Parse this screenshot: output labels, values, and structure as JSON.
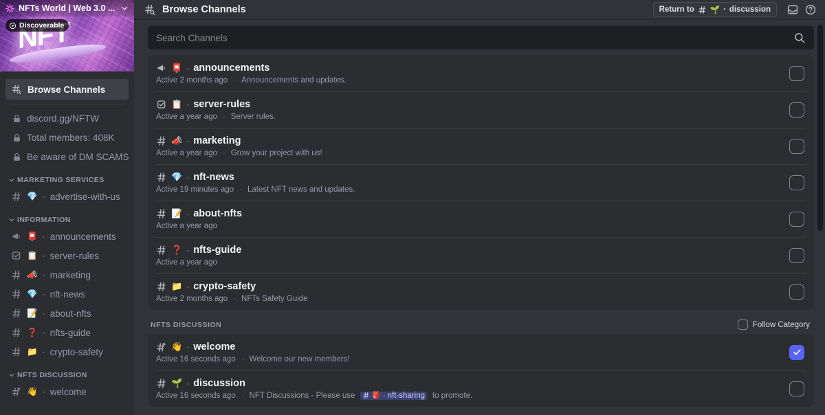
{
  "sidebar": {
    "server_name": "NFTs World | Web 3.0 ...",
    "discoverable_badge": "Discoverable",
    "banner_text": "NFT",
    "browse_channels_label": "Browse Channels",
    "info_rows": [
      {
        "icon": "lock-icon",
        "label": "discord.gg/NFTW"
      },
      {
        "icon": "lock-icon",
        "label": "Total members: 408K"
      },
      {
        "icon": "lock-icon",
        "label": "Be aware of DM SCAMS!"
      }
    ],
    "categories": [
      {
        "name": "MARKETING SERVICES",
        "channels": [
          {
            "icon": "hash-icon",
            "emoji": "💎",
            "sep": "·",
            "label": "advertise-with-us"
          }
        ]
      },
      {
        "name": "INFORMATION",
        "channels": [
          {
            "icon": "announcement-icon",
            "emoji": "📮",
            "sep": "·",
            "label": "announcements"
          },
          {
            "icon": "rules-icon",
            "emoji": "📋",
            "sep": "·",
            "label": "server-rules"
          },
          {
            "icon": "hash-icon",
            "emoji": "📣",
            "sep": "·",
            "label": "marketing"
          },
          {
            "icon": "hash-icon",
            "emoji": "💎",
            "sep": "·",
            "label": "nft-news"
          },
          {
            "icon": "hash-icon",
            "emoji": "📝",
            "sep": "·",
            "label": "about-nfts"
          },
          {
            "icon": "hash-icon",
            "emoji": "❓",
            "sep": "·",
            "label": "nfts-guide"
          },
          {
            "icon": "hash-icon",
            "emoji": "📁",
            "sep": "·",
            "label": "crypto-safety"
          }
        ]
      },
      {
        "name": "NFTS DISCUSSION",
        "channels": [
          {
            "icon": "hash-thread-icon",
            "emoji": "👋",
            "sep": "·",
            "label": "welcome"
          }
        ]
      }
    ]
  },
  "header": {
    "icon": "browse-channels-icon",
    "title": "Browse Channels",
    "return_button": {
      "label": "Return to",
      "channel_icon": "hash-icon",
      "channel_emoji": "🌱",
      "sep": "·",
      "channel_name": "discussion"
    },
    "inbox_icon": "inbox-icon",
    "help_icon": "help-icon"
  },
  "search": {
    "placeholder": "Search Channels",
    "value": "",
    "icon": "search-icon"
  },
  "channel_list": {
    "rows": [
      {
        "icon": "announcement-icon",
        "emoji": "📮",
        "sep": "·",
        "name": "announcements",
        "activity": "Active 2 months ago",
        "meta_sep": "·",
        "topic": "Announcements and updates.",
        "checked": false
      },
      {
        "icon": "rules-icon",
        "emoji": "📋",
        "sep": "·",
        "name": "server-rules",
        "activity": "Active a year ago",
        "meta_sep": "·",
        "topic": "Server rules.",
        "checked": false
      },
      {
        "icon": "hash-icon",
        "emoji": "📣",
        "sep": "·",
        "name": "marketing",
        "activity": "Active a year ago",
        "meta_sep": "·",
        "topic": "Grow your project with us!",
        "checked": false
      },
      {
        "icon": "hash-icon",
        "emoji": "💎",
        "sep": "·",
        "name": "nft-news",
        "activity": "Active 19 minutes ago",
        "meta_sep": "·",
        "topic": "Latest NFT news and updates.",
        "checked": false
      },
      {
        "icon": "hash-icon",
        "emoji": "📝",
        "sep": "·",
        "name": "about-nfts",
        "activity": "Active a year ago",
        "meta_sep": "",
        "topic": "",
        "checked": false
      },
      {
        "icon": "hash-icon",
        "emoji": "❓",
        "sep": "·",
        "name": "nfts-guide",
        "activity": "Active a year ago",
        "meta_sep": "",
        "topic": "",
        "checked": false
      },
      {
        "icon": "hash-icon",
        "emoji": "📁",
        "sep": "·",
        "name": "crypto-safety",
        "activity": "Active 2 months ago",
        "meta_sep": "·",
        "topic": "NFTs Safety Guide",
        "checked": false
      }
    ]
  },
  "category_section": {
    "name": "NFTS DISCUSSION",
    "follow_label": "Follow Category",
    "follow_checked": false,
    "rows": [
      {
        "icon": "hash-thread-icon",
        "emoji": "👋",
        "sep": "·",
        "name": "welcome",
        "activity": "Active 16 seconds ago",
        "meta_sep": "·",
        "topic": "Welcome our new members!",
        "checked": true
      },
      {
        "icon": "hash-icon",
        "emoji": "🌱",
        "sep": "·",
        "name": "discussion",
        "activity": "Active 16 seconds ago",
        "meta_sep": "·",
        "topic_pre": "NFT Discussions - Please use",
        "mention_emoji": "🎒",
        "mention_sep": "·",
        "mention_name": "nft-sharing",
        "topic_post": "to promote.",
        "checked": false
      }
    ]
  },
  "colors": {
    "accent": "#5865f2",
    "sidebar_bg": "#2b2d31",
    "main_bg": "#313338",
    "card_bg": "#2b2d31",
    "text_primary": "#f2f3f5",
    "text_muted": "#949ba4",
    "mention_bg": "#3c4270"
  }
}
